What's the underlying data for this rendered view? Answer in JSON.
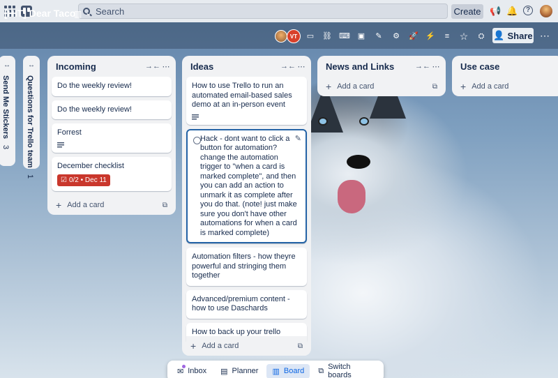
{
  "topbar": {
    "search_placeholder": "Search",
    "create_label": "Create"
  },
  "board": {
    "title": "[HIT] Dear Taco",
    "member_initials": "VT",
    "share_label": "Share"
  },
  "collapsed_lists": [
    {
      "title": "Send Me Stickers",
      "count": "3"
    },
    {
      "title": "Questions for Trello team",
      "count": "1"
    }
  ],
  "lists": {
    "incoming": {
      "title": "Incoming",
      "cards": [
        "Do the weekly review!",
        "Do the weekly review!",
        "Forrest",
        "December checklist"
      ],
      "checklist_badge": "0/2 • Dec 11",
      "add_label": "Add a card"
    },
    "ideas": {
      "title": "Ideas",
      "cards": [
        "How to use Trello to run an automated email-based sales demo at an in-person event",
        "Hack - dont want to click a button for automation? change the automation trigger to \"when a card is marked complete\", and then you can add an action to unmark it as complete after you do that. (note! just make sure you don't have other automations for when a card is marked complete)",
        "Automation filters - how theyre powerful and stringing them together",
        "Advanced/premium content - how to use Daschards",
        "How to back up your trello boards:"
      ],
      "add_label": "Add a card"
    },
    "news": {
      "title": "News and Links",
      "add_label": "Add a card"
    },
    "usecase": {
      "title": "Use case",
      "add_label": "Add a card"
    }
  },
  "bottom_nav": {
    "inbox": "Inbox",
    "planner": "Planner",
    "board": "Board",
    "switch": "Switch boards"
  }
}
